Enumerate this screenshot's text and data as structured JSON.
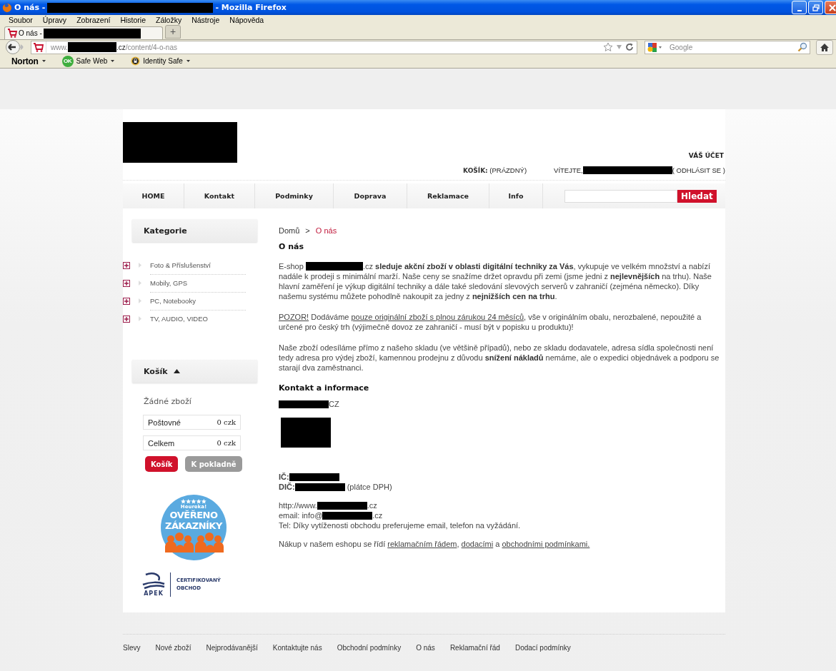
{
  "window": {
    "title": [
      {
        "kind": "text",
        "text": "O nás -"
      },
      {
        "kind": "redacted"
      },
      {
        "kind": "text",
        "text": "- Mozilla Firefox"
      }
    ]
  },
  "menu": [
    "Soubor",
    "Úpravy",
    "Zobrazení",
    "Historie",
    "Záložky",
    "Nástroje",
    "Nápověda"
  ],
  "tabs": [
    {
      "title": [
        {
          "kind": "text",
          "text": "O nás -"
        },
        {
          "kind": "redacted"
        }
      ],
      "selected": true
    }
  ],
  "new_tab": "+",
  "address": [
    {
      "kind": "text",
      "text": "www."
    },
    {
      "kind": "redacted"
    },
    {
      "kind": "host",
      "text": ".cz"
    },
    {
      "kind": "text",
      "text": "/content/4-o-nas"
    }
  ],
  "web_search": {
    "placeholder": "Google"
  },
  "toolbar": [
    {
      "kind": "brand",
      "label": "Norton"
    },
    {
      "kind": "safeweb",
      "label": "Safe Web",
      "badge": "OK"
    },
    {
      "kind": "identity",
      "label": "Identity Safe"
    }
  ],
  "header": {
    "account": "VÁŠ ÚČET",
    "cart_label": "KOŠÍK:",
    "cart_value": "(PRÁZDNÝ)",
    "welcome": [
      {
        "kind": "text",
        "text": "VÍTEJTE,"
      },
      {
        "kind": "redacted"
      },
      {
        "kind": "action",
        "text": "( ODHLÁSIT SE )"
      }
    ]
  },
  "nav": [
    "HOME",
    "Kontakt",
    "Podminky",
    "Doprava",
    "Reklamace",
    "Info"
  ],
  "search_button": "Hledat",
  "sidebar": {
    "categories_title": "Kategorie",
    "categories": [
      "Foto & Příslušenství",
      "Mobily, GPS",
      "PC, Notebooky",
      "TV, AUDIO, VIDEO"
    ],
    "cart_title": "Košík",
    "cart_empty": "Žádné zboží",
    "cart_rows": [
      {
        "label": "Poštovné",
        "value": "0 czk"
      },
      {
        "label": "Celkem",
        "value": "0 czk"
      }
    ],
    "cart_buttons": [
      {
        "label": "Košík",
        "kind": "primary"
      },
      {
        "label": "K pokladně",
        "kind": "secondary"
      }
    ],
    "heureka": {
      "brand": "Heureka!",
      "line_1": "OVĚŘENO",
      "line_2": "ZÁKAZNÍKY"
    },
    "apek": {
      "name": "APEK",
      "line_1": "CERTIFIKOVANÝ",
      "line_2": "OBCHOD"
    }
  },
  "breadcrumb": [
    {
      "label": "Domů",
      "selected": false
    },
    {
      "label": "O nás",
      "selected": true
    }
  ],
  "breadcrumb_separator": ">",
  "heading": "O nás",
  "paragraphs": [
    [
      {
        "kind": "text",
        "text": "E-shop "
      },
      {
        "kind": "redacted"
      },
      {
        "kind": "text",
        "text": ".cz **sleduje akční zboží v oblasti digitální techniky za Vás**, vykupuje ve velkém množství a nabízí nadále k prodeji s minimální marží. Naše ceny se snažíme držet opravdu při zemi (jsme jedni z **nejlevnějších** na trhu). Naše hlavní zaměření je výkup digitální techniky a dále také sledování slevových serverů v zahraničí (zejména německo). Díky našemu systému můžete pohodlně nakoupit za jedny z **nejnižších cen na trhu**."
      }
    ],
    [
      {
        "kind": "link",
        "text": "POZOR!"
      },
      {
        "kind": "text",
        "text": " Dodáváme "
      },
      {
        "kind": "link",
        "text": "pouze originální zboží s plnou zárukou 24 měsíců"
      },
      {
        "kind": "text",
        "text": ", vše v originálním obalu, nerozbalené, nepoužité a určené pro český trh (výjimečně dovoz ze zahraničí - musí být v popisku u produktu)!"
      }
    ],
    [
      {
        "kind": "text",
        "text": "Naše zboží odesíláme přímo z našeho skladu (ve většině případů), nebo ze skladu dodavatele, adresa sídla společnosti není tedy adresa pro výdej zboží, kamennou prodejnu z důvodu **snížení nákladů** nemáme, ale o expedici objednávek a podporu se starají dva zaměstnanci."
      }
    ]
  ],
  "contact_heading": "Kontakt a informace",
  "contact_blocks": [
    [
      [
        {
          "kind": "redacted"
        },
        {
          "kind": "text",
          "text": "CZ"
        }
      ]
    ],
    [
      [
        {
          "kind": "redacted_block"
        }
      ]
    ],
    [
      [
        {
          "kind": "label",
          "text": "IČ:"
        },
        {
          "kind": "redacted"
        }
      ],
      [
        {
          "kind": "label",
          "text": "DIČ:"
        },
        {
          "kind": "redacted"
        },
        {
          "kind": "text",
          "text": " (plátce DPH)"
        }
      ]
    ],
    [
      [
        {
          "kind": "text",
          "text": "http://www."
        },
        {
          "kind": "redacted"
        },
        {
          "kind": "text",
          "text": ".cz"
        }
      ],
      [
        {
          "kind": "text",
          "text": "email: info@"
        },
        {
          "kind": "redacted"
        },
        {
          "kind": "text",
          "text": ".cz"
        }
      ],
      [
        {
          "kind": "text",
          "text": "Tel: Díky vytíženosti obchodu preferujeme email, telefon na vyžádání."
        }
      ]
    ]
  ],
  "terms": [
    {
      "kind": "text",
      "text": "Nákup v našem eshopu se řídí "
    },
    {
      "kind": "link",
      "text": "reklamačním řádem"
    },
    {
      "kind": "text",
      "text": ", "
    },
    {
      "kind": "link",
      "text": "dodacími"
    },
    {
      "kind": "text",
      "text": " a "
    },
    {
      "kind": "link",
      "text": "obchodními podmínkami."
    }
  ],
  "footer": [
    "Slevy",
    "Nové zboží",
    "Nejprodávanější",
    "Kontaktujte nás",
    "Obchodní podmínky",
    "O nás",
    "Reklamační řád",
    "Dodací podmínky"
  ]
}
